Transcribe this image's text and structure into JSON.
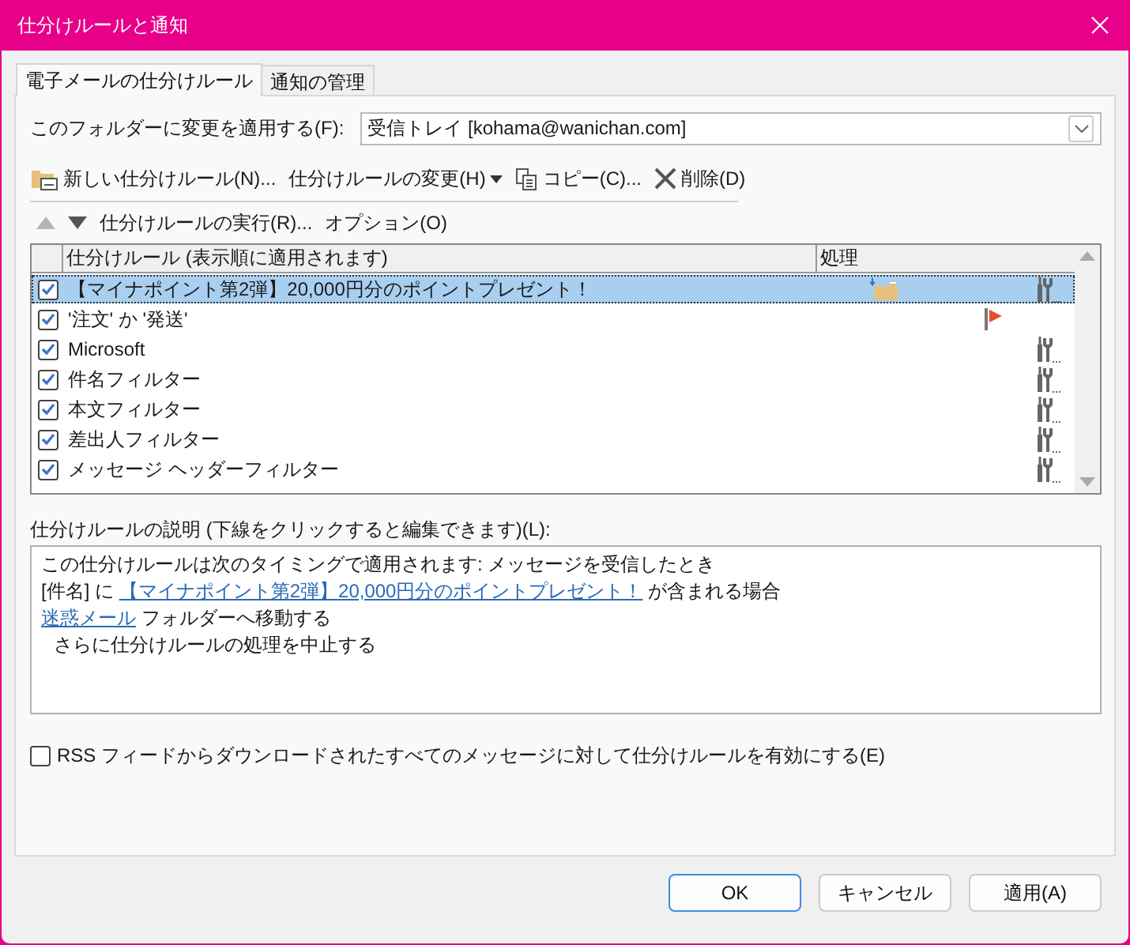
{
  "window": {
    "title": "仕分けルールと通知"
  },
  "tabs": [
    {
      "label": "電子メールの仕分けルール",
      "selected": true
    },
    {
      "label": "通知の管理",
      "selected": false
    }
  ],
  "folder": {
    "label": "このフォルダーに変更を適用する(F):",
    "value": "受信トレイ [kohama@wanichan.com]"
  },
  "toolbar": [
    {
      "kind": "new-rule",
      "label": "新しい仕分けルール(N)...",
      "dropdown": false
    },
    {
      "kind": "plain",
      "label": "仕分けルールの変更(H)",
      "dropdown": true
    },
    {
      "kind": "copy",
      "label": "コピー(C)...",
      "dropdown": false
    },
    {
      "kind": "delete",
      "label": "削除(D)",
      "dropdown": false
    }
  ],
  "order_toolbar": {
    "move_up": {
      "disabled": true
    },
    "move_down": {
      "disabled": false
    },
    "buttons": [
      "仕分けルールの実行(R)...",
      "オプション(O)"
    ]
  },
  "rules_table": {
    "columns": [
      "仕分けルール (表示順に適用されます)",
      "処理"
    ],
    "rows": [
      {
        "name": "【マイナポイント第2弾】20,000円分のポイントプレゼント！",
        "checked": true,
        "selected": true,
        "actions": [
          {
            "kind": "move"
          },
          {
            "kind": "custom"
          }
        ]
      },
      {
        "name": "'注文' か '発送'",
        "checked": true,
        "selected": false,
        "actions": [
          {
            "kind": "flag"
          }
        ]
      },
      {
        "name": "Microsoft",
        "checked": true,
        "selected": false,
        "actions": [
          {
            "kind": "custom"
          }
        ]
      },
      {
        "name": "件名フィルター",
        "checked": true,
        "selected": false,
        "actions": [
          {
            "kind": "custom"
          }
        ]
      },
      {
        "name": "本文フィルター",
        "checked": true,
        "selected": false,
        "actions": [
          {
            "kind": "custom"
          }
        ]
      },
      {
        "name": "差出人フィルター",
        "checked": true,
        "selected": false,
        "actions": [
          {
            "kind": "custom"
          }
        ]
      },
      {
        "name": "メッセージ ヘッダーフィルター",
        "checked": true,
        "selected": false,
        "actions": [
          {
            "kind": "custom"
          }
        ]
      }
    ]
  },
  "description": {
    "label": "仕分けルールの説明 (下線をクリックすると編集できます)(L):",
    "lines": [
      {
        "indent": false,
        "parts": [
          {
            "text": "この仕分けルールは次のタイミングで適用されます: メッセージを受信したとき",
            "link": false
          }
        ]
      },
      {
        "indent": false,
        "parts": [
          {
            "text": "[件名] に ",
            "link": false
          },
          {
            "text": "【マイナポイント第2弾】20,000円分のポイントプレゼント！",
            "link": true
          },
          {
            "text": " が含まれる場合",
            "link": false
          }
        ]
      },
      {
        "indent": false,
        "parts": [
          {
            "text": "迷惑メール",
            "link": true
          },
          {
            "text": " フォルダーへ移動する",
            "link": false
          }
        ]
      },
      {
        "indent": true,
        "parts": [
          {
            "text": "さらに仕分けルールの処理を中止する",
            "link": false
          }
        ]
      }
    ]
  },
  "rss_option": {
    "label": "RSS フィードからダウンロードされたすべてのメッセージに対して仕分けルールを有効にする(E)",
    "checked": false
  },
  "buttons": [
    {
      "label": "OK",
      "default": true
    },
    {
      "label": "キャンセル",
      "default": false
    },
    {
      "label": "適用(A)",
      "default": false
    }
  ]
}
